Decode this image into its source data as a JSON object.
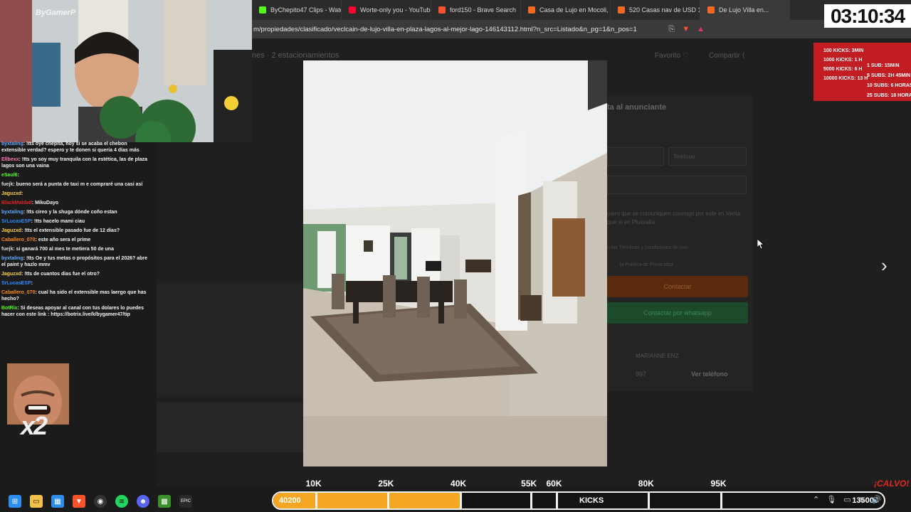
{
  "browser": {
    "tabs": [
      {
        "title": "ByChepito47 Clips - Watch",
        "color": "#53fc18"
      },
      {
        "title": "Worte-only you - YouTube",
        "color": "#ff0033"
      },
      {
        "title": "ford150 - Brave Search",
        "color": "#fb542b"
      },
      {
        "title": "Casa de Lujo en Mocoli, G",
        "color": "#f26b21"
      },
      {
        "title": "520 Casas nav de USD 1",
        "color": "#f26b21"
      },
      {
        "title": "De Lujo Villa en...",
        "color": "#f26b21"
      }
    ],
    "url": "m/propiedades/clasificado/veclcain-de-lujo-villa-en-plaza-lagos-al-mejor-lago-146143112.html?n_src=Listado&n_pg=1&n_pos=1"
  },
  "page": {
    "subtitle": "nes · 2 estacionamientos",
    "favorite_label": "Favorito",
    "share_label": "Compartir",
    "contact_title": "ta al anunciante",
    "phone_placeholder": "Teléfono",
    "message_text": "uiero que se comuniquen conmigo por este en Venta que vi en Plusvalía",
    "terms_text": "n los Términos y condiciones de uso.",
    "privacy_text": "la Política de Privacidad",
    "contact_button": "Contactar",
    "whatsapp_button": "Contactar por whatsapp",
    "agent_name": "MARIANNE ENZ",
    "phone_partial": "997",
    "view_phone": "Ver teléfono"
  },
  "stream": {
    "brand": "ByGamerP",
    "timer": "03:10:34",
    "goals_left": [
      "100 KICKS: 3MIN",
      "1000 KICKS: 1 H",
      "5000 KICKS: 6 H",
      "10000 KICKS: 13 H"
    ],
    "goals_right": [
      "1 SUB: 15MIN",
      "5 SUBS: 2H 45MIN",
      "10 SUBS: 6 HORAS",
      "25 SUBS: 16 HORAS"
    ],
    "meme_multiplier": "x2",
    "calvo_label": "¡CALVO!"
  },
  "chat": [
    {
      "user": "byxtaling",
      "color": "#5fa9ff",
      "text": ": !tts oye chepita, hoy si se acaba el chebon extensible verdad? espero y te donen si quería 4 días más"
    },
    {
      "user": "Ellbexx",
      "color": "#ff7ab5",
      "text": ": !tts yo soy muy tranquila con la estética, las de plaza lagos son una vaina"
    },
    {
      "user": "eSaul6",
      "color": "#53fc18",
      "text": ":"
    },
    {
      "user": "fuejk",
      "color": "#dddddd",
      "text": ": bueno será a punta de taxi m e compraré una casi así"
    },
    {
      "user": "Jaguzxd",
      "color": "#ffd04d",
      "text": ":"
    },
    {
      "user": "BlackMaldad",
      "color": "#e02424",
      "text": ": MikuDayo"
    },
    {
      "user": "byxtaling",
      "color": "#5fa9ff",
      "text": ": !tts cireo y la shuga dónde coño estan"
    },
    {
      "user": "SrLucasESP",
      "color": "#2e8bff",
      "text": ": !tts hacelo mami ciau"
    },
    {
      "user": "Jaguzxd",
      "color": "#ffd04d",
      "text": ": !tts el extensible pasado fue de 12 días?"
    },
    {
      "user": "Caballero_070",
      "color": "#ff8a1e",
      "text": ": este año sera el prime"
    },
    {
      "user": "fuejk",
      "color": "#dddddd",
      "text": ": si ganará 700 al mes te metiera 50 de una"
    },
    {
      "user": "byxtaling",
      "color": "#5fa9ff",
      "text": ": !tts Oe y tus metas o propósitos para el 2026? abre el paint y hazlo mmv"
    },
    {
      "user": "Jaguzxd",
      "color": "#ffd04d",
      "text": ": !tts de cuantos dias fue el otro?"
    },
    {
      "user": "SrLucasESP",
      "color": "#2e8bff",
      "text": ":"
    },
    {
      "user": "Caballero_070",
      "color": "#ff8a1e",
      "text": ": cual ha sido el extensible mas laergo que has hecho?"
    },
    {
      "user": "BotRix",
      "color": "#53fc18",
      "text": ": Si deseas apoyar al canal con tus dolares lo puedes hacer con este link : https://botrix.live/k/bygamer47/tip"
    }
  ],
  "progress": {
    "current_label": "40200",
    "center_label": "KICKS",
    "total_label": "135000",
    "fill_fraction": 0.304,
    "milestones": [
      {
        "label": "10K",
        "fraction": 0.068
      },
      {
        "label": "25K",
        "fraction": 0.186
      },
      {
        "label": "40K",
        "fraction": 0.304
      },
      {
        "label": "55K",
        "fraction": 0.419
      },
      {
        "label": "60K",
        "fraction": 0.46
      },
      {
        "label": "80K",
        "fraction": 0.61
      },
      {
        "label": "95K",
        "fraction": 0.728
      }
    ]
  },
  "taskbar": {
    "icons": [
      "windows-start-icon",
      "file-explorer-icon",
      "ms-store-icon",
      "brave-browser-icon",
      "obs-icon",
      "spotify-icon",
      "discord-icon",
      "minecraft-icon",
      "epic-games-icon"
    ],
    "epic_label": "EPIC"
  }
}
